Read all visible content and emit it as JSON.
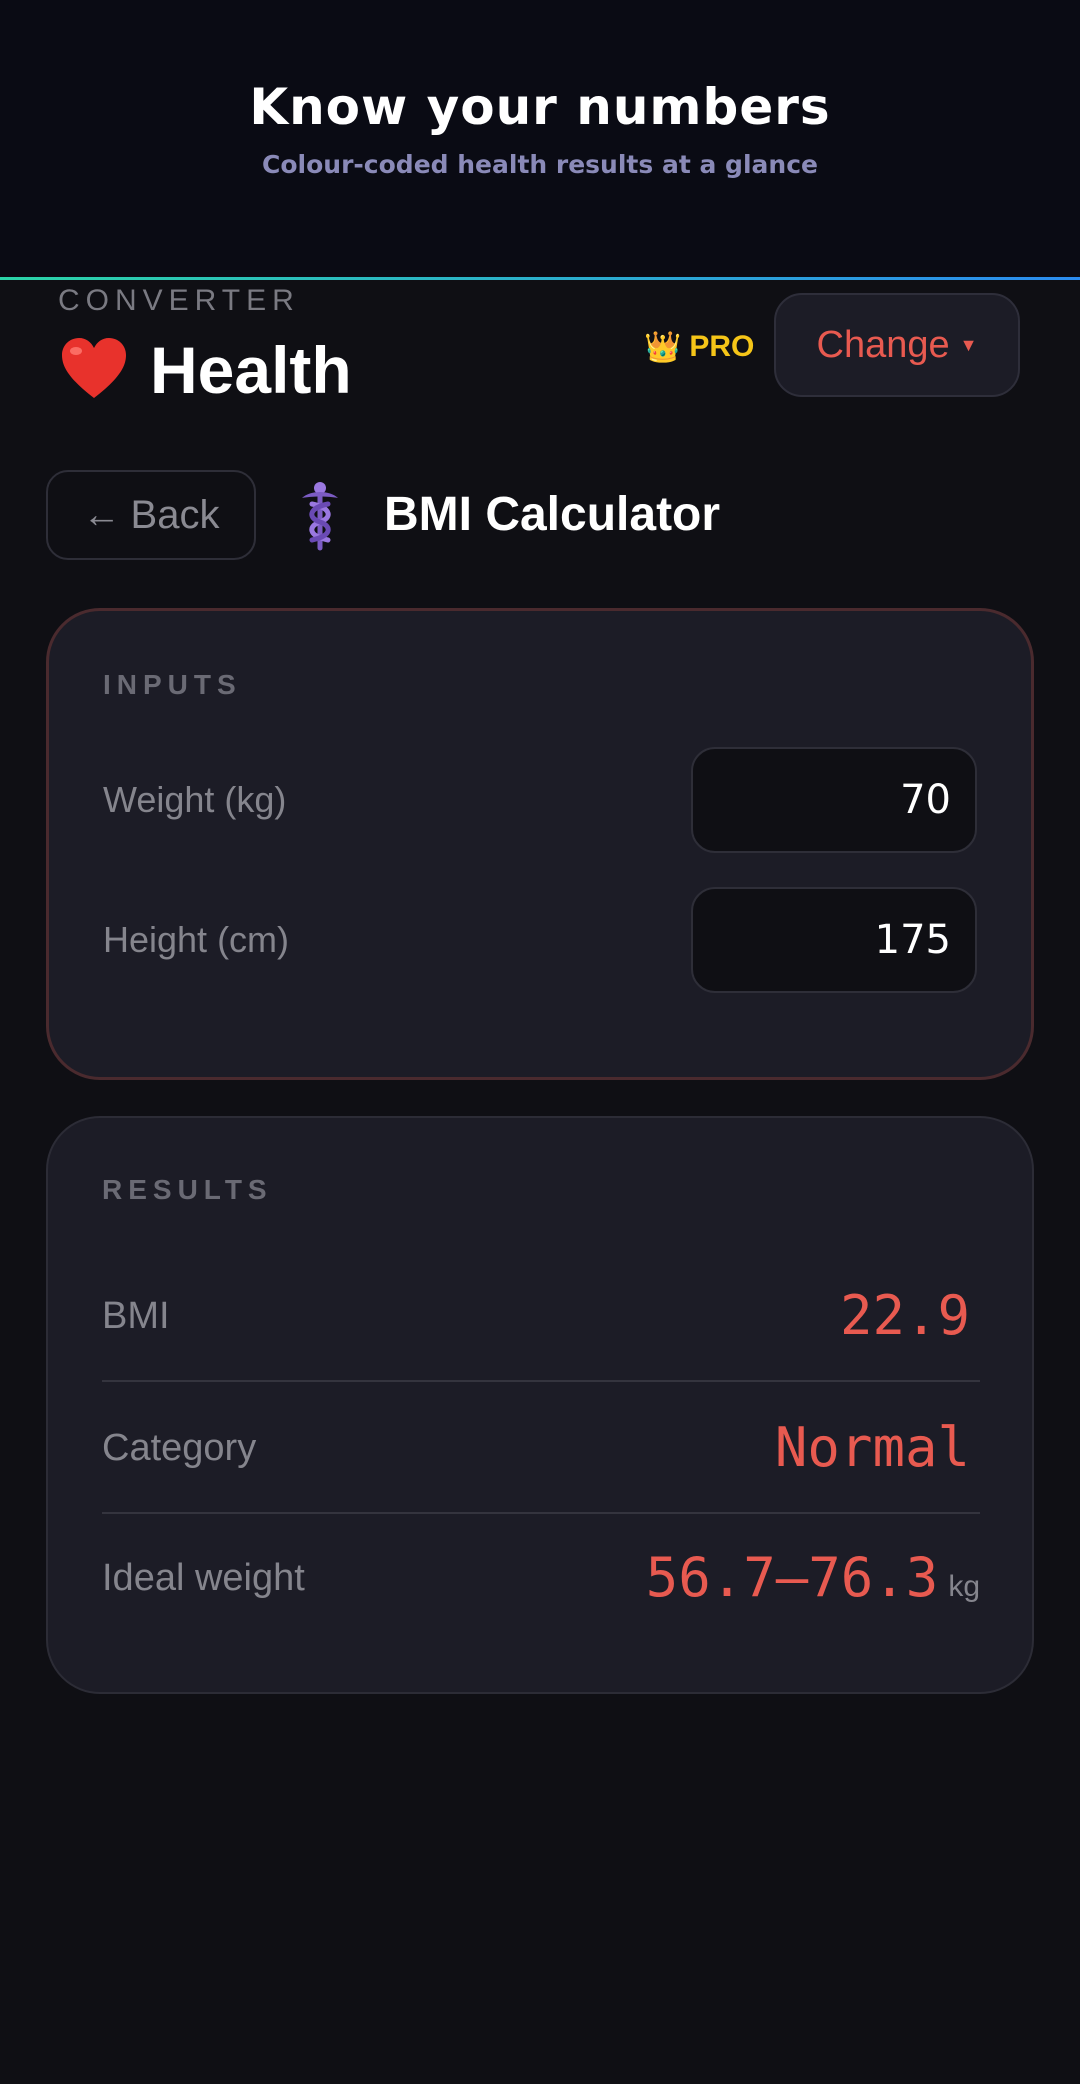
{
  "banner": {
    "title": "Know your numbers",
    "subtitle": "Colour-coded health results at a glance"
  },
  "header": {
    "kicker": "CONVERTER",
    "title": "Health",
    "heart_icon": "heart-icon",
    "pro_label": "PRO",
    "crown_icon": "crown-icon",
    "change_label": "Change"
  },
  "calculator": {
    "back_label": "Back",
    "title": "BMI Calculator",
    "icon": "caduceus-icon"
  },
  "inputs": {
    "section_label": "INPUTS",
    "weight": {
      "label": "Weight (kg)",
      "value": "70"
    },
    "height": {
      "label": "Height (cm)",
      "value": "175"
    }
  },
  "results": {
    "section_label": "RESULTS",
    "bmi": {
      "label": "BMI",
      "value": "22.9"
    },
    "category": {
      "label": "Category",
      "value": "Normal"
    },
    "ideal_weight": {
      "label": "Ideal weight",
      "value": "56.7–76.3",
      "unit": "kg"
    }
  },
  "colors": {
    "accent": "#e85a50",
    "pro": "#f5c518",
    "background": "#0f0f14",
    "card": "#1c1c26"
  }
}
